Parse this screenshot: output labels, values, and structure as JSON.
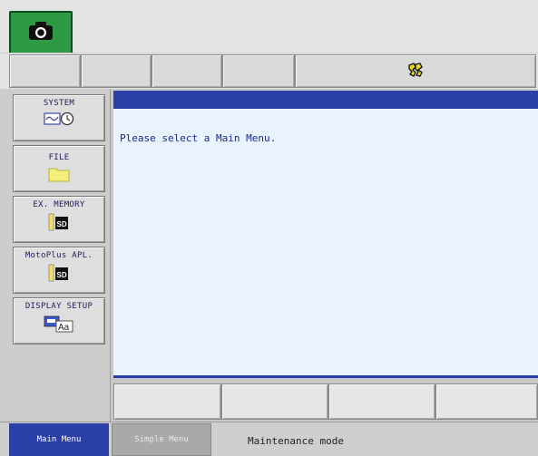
{
  "toolbar": {
    "camera_icon": "camera-icon",
    "status_icon": "robot-status-icon"
  },
  "left_menu": {
    "items": [
      {
        "label": "SYSTEM",
        "icon": "system-icon"
      },
      {
        "label": "FILE",
        "icon": "folder-icon"
      },
      {
        "label": "EX. MEMORY",
        "icon": "sd-card-icon"
      },
      {
        "label": "MotoPlus APL.",
        "icon": "sd-card-icon"
      },
      {
        "label": "DISPLAY SETUP",
        "icon": "display-setup-icon"
      }
    ]
  },
  "main": {
    "message": "Please select a Main Menu."
  },
  "bottom": {
    "main_menu_label": "Main Menu",
    "simple_menu_label": "Simple Menu",
    "status": "Maintenance mode"
  },
  "colors": {
    "accent_blue": "#2b3fa8",
    "camera_green": "#2f9a45",
    "content_bg": "#e9f2ff",
    "sd_yellow": "#f0e060"
  }
}
